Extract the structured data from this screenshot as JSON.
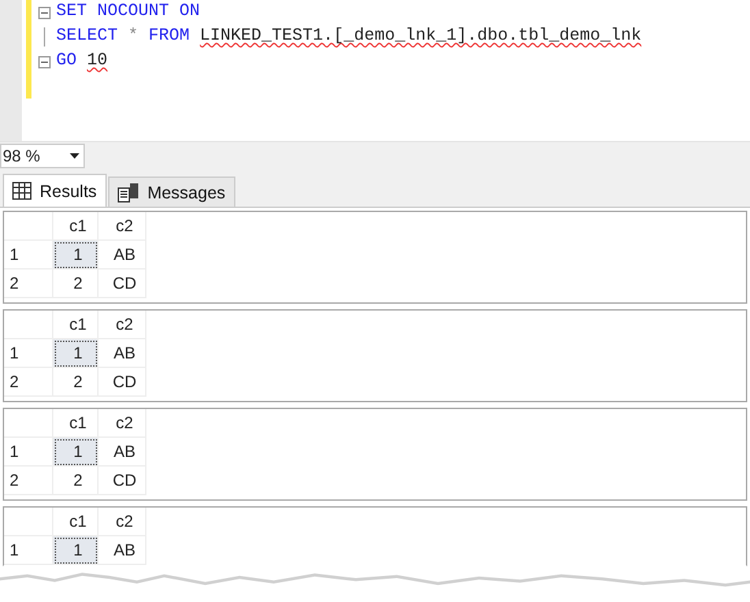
{
  "editor": {
    "lines": [
      {
        "fold": true,
        "tokens": [
          {
            "text": "SET",
            "kind": "keyword"
          },
          {
            "text": "NOCOUNT",
            "kind": "keyword"
          },
          {
            "text": "ON",
            "kind": "keyword"
          }
        ]
      },
      {
        "fold": false,
        "tokens": [
          {
            "text": "SELECT",
            "kind": "keyword"
          },
          {
            "text": "*",
            "kind": "operator"
          },
          {
            "text": "FROM",
            "kind": "keyword"
          },
          {
            "text": "LINKED_TEST1.[_demo_lnk_1].dbo.tbl_demo_lnk",
            "kind": "plain",
            "squiggle": true
          }
        ]
      },
      {
        "fold": true,
        "tokens": [
          {
            "text": "GO",
            "kind": "keyword"
          },
          {
            "text": "10",
            "kind": "plain",
            "squiggle": true
          }
        ]
      }
    ]
  },
  "zoom": {
    "value": "98 %"
  },
  "tabs": [
    {
      "label": "Results",
      "selected": true,
      "kind": "grid"
    },
    {
      "label": "Messages",
      "selected": false,
      "kind": "messages"
    }
  ],
  "results": [
    {
      "columns": [
        "c1",
        "c2"
      ],
      "rows": [
        {
          "number": "1",
          "cells": [
            {
              "text": "1",
              "selected": true
            },
            {
              "text": "AB",
              "selected": false
            }
          ]
        },
        {
          "number": "2",
          "cells": [
            {
              "text": "2",
              "selected": false
            },
            {
              "text": "CD",
              "selected": false
            }
          ]
        }
      ]
    },
    {
      "columns": [
        "c1",
        "c2"
      ],
      "rows": [
        {
          "number": "1",
          "cells": [
            {
              "text": "1",
              "selected": true
            },
            {
              "text": "AB",
              "selected": false
            }
          ]
        },
        {
          "number": "2",
          "cells": [
            {
              "text": "2",
              "selected": false
            },
            {
              "text": "CD",
              "selected": false
            }
          ]
        }
      ]
    },
    {
      "columns": [
        "c1",
        "c2"
      ],
      "rows": [
        {
          "number": "1",
          "cells": [
            {
              "text": "1",
              "selected": true
            },
            {
              "text": "AB",
              "selected": false
            }
          ]
        },
        {
          "number": "2",
          "cells": [
            {
              "text": "2",
              "selected": false
            },
            {
              "text": "CD",
              "selected": false
            }
          ]
        }
      ]
    },
    {
      "columns": [
        "c1",
        "c2"
      ],
      "rows": [
        {
          "number": "1",
          "cells": [
            {
              "text": "1",
              "selected": true
            },
            {
              "text": "AB",
              "selected": false
            }
          ]
        }
      ]
    }
  ]
}
